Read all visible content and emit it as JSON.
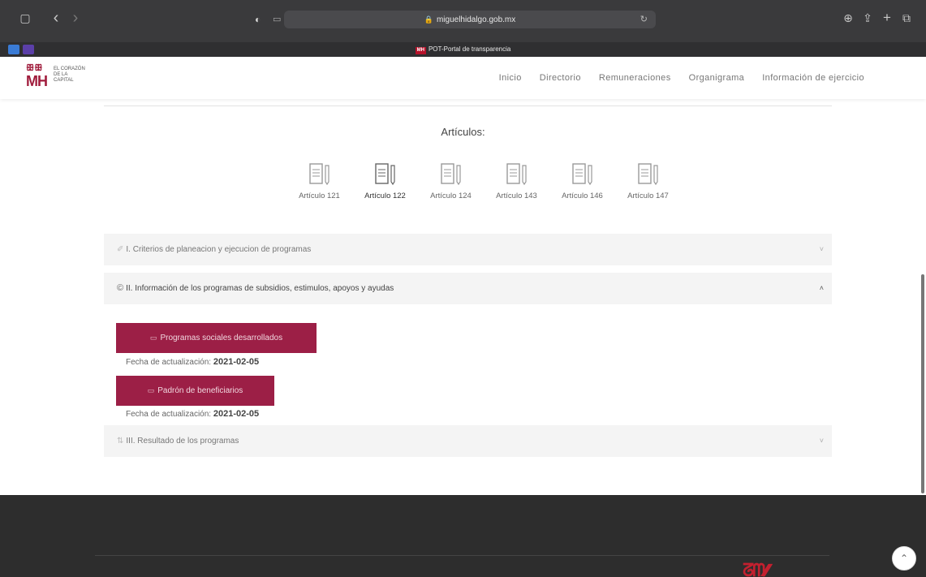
{
  "browser": {
    "url": "miguelhidalgo.gob.mx",
    "tab_title": "POT-Portal de transparencia",
    "tab_favicon": "MH",
    "icons": {
      "sidebar": "▢",
      "back": "‹",
      "forward": "›",
      "shield": "◐",
      "page": "▭",
      "lock": "🔒",
      "reload": "↻",
      "download": "⊕",
      "share": "⇪",
      "new_tab": "+",
      "tabs": "⧉"
    }
  },
  "site": {
    "logo": {
      "mark": "MH",
      "line1": "EL CORAZÓN",
      "line2": "DE LA",
      "line3": "CAPITAL"
    },
    "nav": [
      "Inicio",
      "Directorio",
      "Remuneraciones",
      "Organigrama",
      "Información de ejercicio"
    ]
  },
  "section_title": "Artículos:",
  "articles": [
    {
      "label": "Artículo 121",
      "active": false
    },
    {
      "label": "Artículo 122",
      "active": true
    },
    {
      "label": "Artículo 124",
      "active": false
    },
    {
      "label": "Artículo 143",
      "active": false
    },
    {
      "label": "Artículo 146",
      "active": false
    },
    {
      "label": "Artículo 147",
      "active": false
    }
  ],
  "accordion": [
    {
      "icon": "✐",
      "title": "I. Criterios de planeacion y ejecucion de programas",
      "chevron": "˅"
    },
    {
      "icon": "©",
      "title": "II. Información de los programas de subsidios, estimulos, apoyos y ayudas",
      "chevron": "˄"
    },
    {
      "icon": "⇅",
      "title": "III. Resultado de los programas",
      "chevron": "˅"
    }
  ],
  "items": [
    {
      "button": "Programas sociales desarrollados",
      "date_label": "Fecha de actualización:",
      "date": "2021-02-05"
    },
    {
      "button": "Padrón de beneficiarios",
      "date_label": "Fecha de actualización:",
      "date": "2021-02-05"
    }
  ],
  "colors": {
    "accent": "#9c1f46",
    "chrome": "#3a3a3c",
    "footer": "#2d2d2d"
  },
  "back_to_top_icon": "⌃"
}
